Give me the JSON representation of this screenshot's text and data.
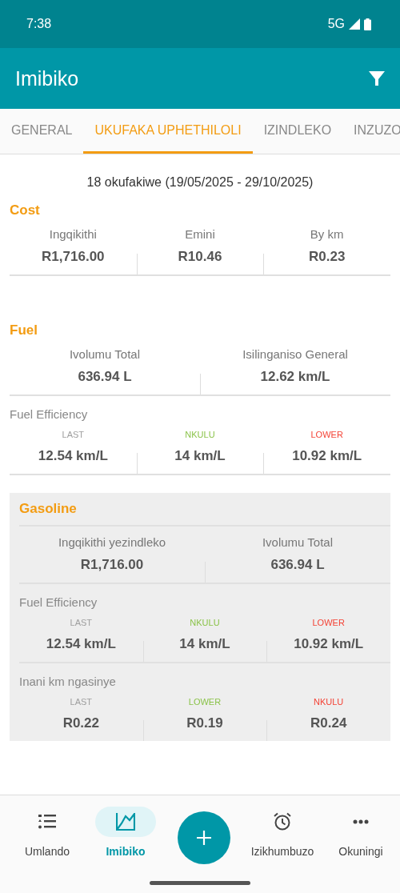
{
  "status_bar": {
    "time": "7:38",
    "network": "5G"
  },
  "app_bar": {
    "title": "Imibiko"
  },
  "tabs": [
    {
      "label": "GENERAL",
      "selected": false
    },
    {
      "label": "UKUFAKA UPHETHILOLI",
      "selected": true
    },
    {
      "label": "IZINDLEKO",
      "selected": false
    },
    {
      "label": "INZUZO",
      "selected": false
    }
  ],
  "summary": "18 okufakiwe (19/05/2025 - 29/10/2025)",
  "sections": [
    {
      "title": "Cost",
      "kind": "plain",
      "groups": [
        {
          "kind": "totals",
          "stats": [
            {
              "label": "Ingqikithi",
              "value": "R1,716.00"
            },
            {
              "label": "Emini",
              "value": "R10.46"
            },
            {
              "label": "By km",
              "value": "R0.23"
            }
          ]
        }
      ]
    },
    {
      "title": "Fuel",
      "kind": "plain",
      "groups": [
        {
          "kind": "totals",
          "stats": [
            {
              "label": "Ivolumu Total",
              "value": "636.94 L"
            },
            {
              "label": "Isilinganiso General",
              "value": "12.62 km/L"
            }
          ]
        },
        {
          "kind": "ranking",
          "heading": "Fuel Efficiency",
          "stats": [
            {
              "label": "LAST",
              "value": "12.54 km/L",
              "color": "#9e9e9e"
            },
            {
              "label": "NKULU",
              "value": "14 km/L",
              "color": "#8bc34a"
            },
            {
              "label": "LOWER",
              "value": "10.92 km/L",
              "color": "#f44336"
            }
          ]
        }
      ]
    },
    {
      "title": "Gasoline",
      "kind": "panel",
      "groups": [
        {
          "kind": "totals",
          "stats": [
            {
              "label": "Ingqikithi yezindleko",
              "value": "R1,716.00"
            },
            {
              "label": "Ivolumu Total",
              "value": "636.94 L"
            }
          ]
        },
        {
          "kind": "ranking",
          "heading": "Fuel Efficiency",
          "stats": [
            {
              "label": "LAST",
              "value": "12.54 km/L",
              "color": "#9e9e9e"
            },
            {
              "label": "NKULU",
              "value": "14 km/L",
              "color": "#8bc34a"
            },
            {
              "label": "LOWER",
              "value": "10.92 km/L",
              "color": "#f44336"
            }
          ]
        },
        {
          "kind": "ranking",
          "heading": "Inani km ngasinye",
          "stats": [
            {
              "label": "LAST",
              "value": "R0.22",
              "color": "#9e9e9e"
            },
            {
              "label": "LOWER",
              "value": "R0.19",
              "color": "#8bc34a"
            },
            {
              "label": "NKULU",
              "value": "R0.24",
              "color": "#f44336"
            }
          ]
        }
      ]
    }
  ],
  "bottom_nav": [
    {
      "label": "Umlando",
      "selected": false
    },
    {
      "label": "Imibiko",
      "selected": true
    },
    {
      "label": "Izikhumbuzo",
      "selected": false
    },
    {
      "label": "Okuningi",
      "selected": false
    }
  ]
}
